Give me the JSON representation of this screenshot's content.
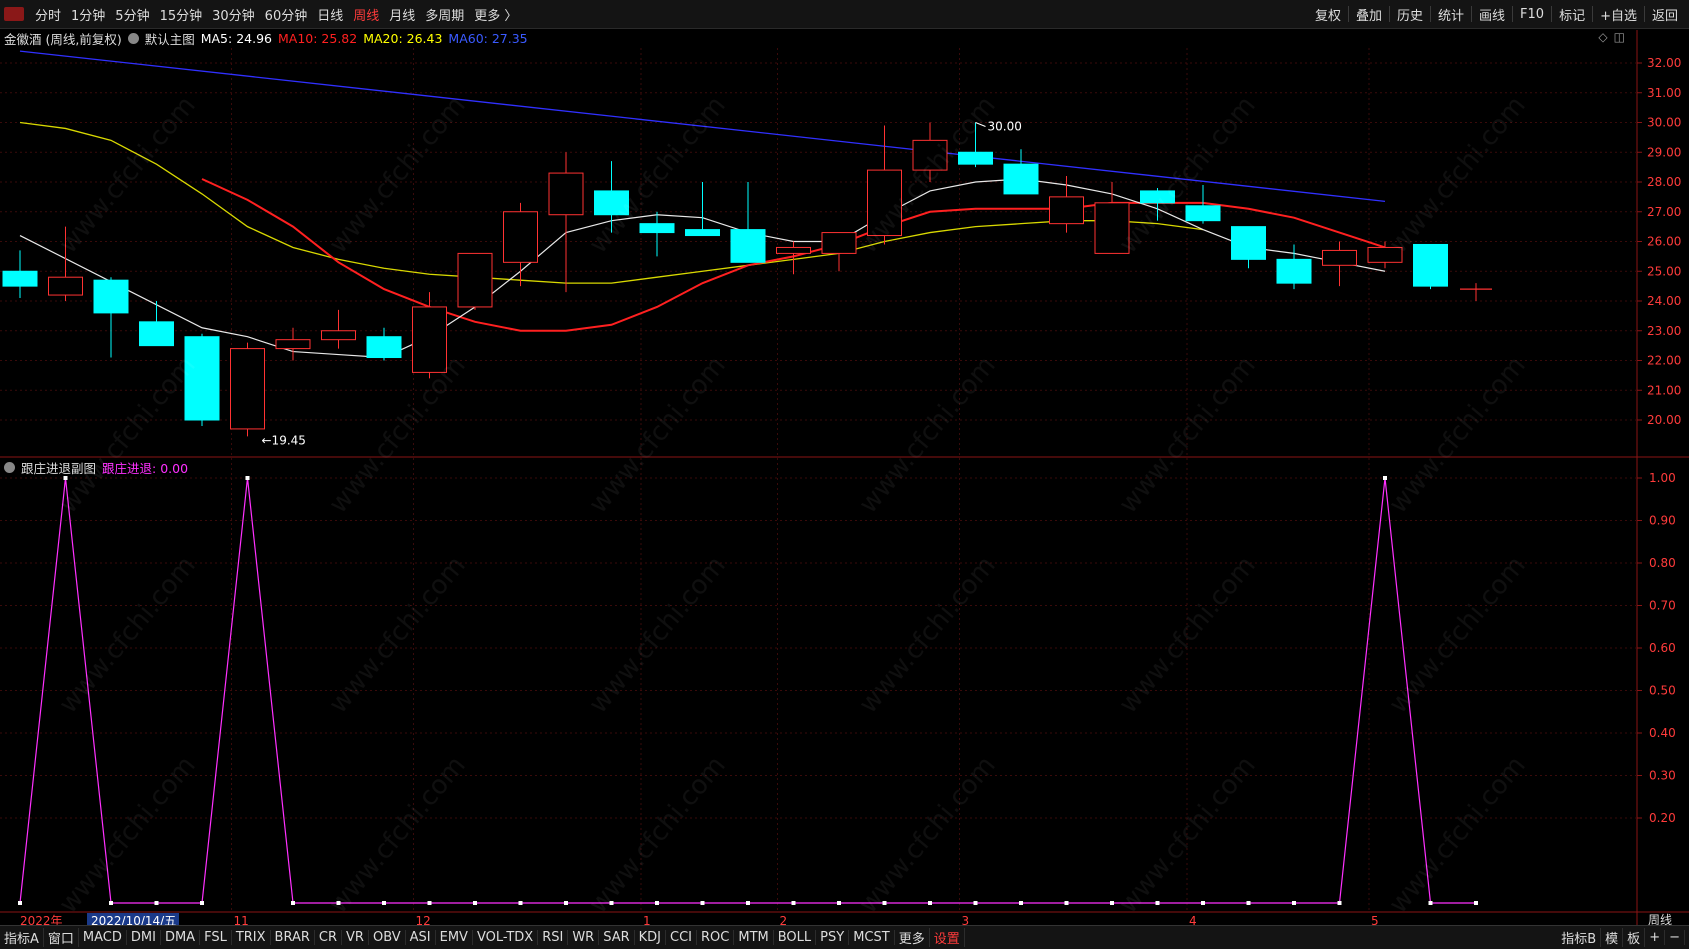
{
  "toolbar": {
    "periods": [
      "分时",
      "1分钟",
      "5分钟",
      "15分钟",
      "30分钟",
      "60分钟",
      "日线",
      "周线",
      "月线",
      "多周期",
      "更多 〉"
    ],
    "active_period": "周线",
    "right_buttons": [
      "复权",
      "叠加",
      "历史",
      "统计",
      "画线",
      "F10",
      "标记",
      "+自选",
      "返回"
    ]
  },
  "main_info": {
    "stock": "金徽酒 (周线,前复权)",
    "template": "默认主图",
    "ma5": "MA5: 24.96",
    "ma10": "MA10: 25.82",
    "ma20": "MA20: 26.43",
    "ma60": "MA60: 27.35",
    "colors": {
      "ma5": "#ffffff",
      "ma10": "#ff2020",
      "ma20": "#ffff00",
      "ma60": "#3030ff"
    }
  },
  "sub_info": {
    "name": "跟庄进退副图",
    "value": "跟庄进退: 0.00"
  },
  "x_axis": {
    "labels": [
      {
        "text": "2022年",
        "bar": 0
      },
      {
        "text": "2022/10/14/五",
        "bar": 2
      },
      {
        "text": "11",
        "bar": 5
      },
      {
        "text": "12",
        "bar": 9
      },
      {
        "text": "1",
        "bar": 14
      },
      {
        "text": "2",
        "bar": 17
      },
      {
        "text": "3",
        "bar": 21
      },
      {
        "text": "4",
        "bar": 26
      },
      {
        "text": "5",
        "bar": 30
      }
    ],
    "right_label": "周线"
  },
  "bottom_tabs": [
    "指标A",
    "窗口",
    "MACD",
    "DMI",
    "DMA",
    "FSL",
    "TRIX",
    "BRAR",
    "CR",
    "VR",
    "OBV",
    "ASI",
    "EMV",
    "VOL-TDX",
    "RSI",
    "WR",
    "SAR",
    "KDJ",
    "CCI",
    "ROC",
    "MTM",
    "BOLL",
    "PSY",
    "MCST",
    "更多",
    "设置"
  ],
  "bottom_right": [
    "指标B",
    "模",
    "板",
    "+",
    "−"
  ],
  "watermark": "www.cfchi.com",
  "chart_data": [
    {
      "type": "candlestick",
      "title": "金徽酒 (周线,前复权)",
      "y_ticks": [
        "32.00",
        "31.00",
        "30.00",
        "29.00",
        "28.00",
        "27.00",
        "26.00",
        "25.00",
        "24.00",
        "23.00",
        "22.00",
        "21.00",
        "20.00"
      ],
      "ylim": [
        19.2,
        32.7
      ],
      "annotations": [
        {
          "text": "30.00",
          "bar": 21,
          "value": 30.0
        },
        {
          "text": "19.45",
          "bar": 5,
          "value": 19.45
        }
      ],
      "colors": {
        "up": "#ff3232",
        "down": "#00ffff"
      },
      "ohlc": [
        [
          25.0,
          25.7,
          24.1,
          24.5
        ],
        [
          24.2,
          26.5,
          24.0,
          24.8
        ],
        [
          24.7,
          24.8,
          22.1,
          23.6
        ],
        [
          23.3,
          24.0,
          22.6,
          22.5
        ],
        [
          22.8,
          22.9,
          19.8,
          20.0
        ],
        [
          19.7,
          22.6,
          19.45,
          22.4
        ],
        [
          22.4,
          23.1,
          22.0,
          22.7
        ],
        [
          22.7,
          23.7,
          22.4,
          23.0
        ],
        [
          22.8,
          23.1,
          22.0,
          22.1
        ],
        [
          21.6,
          24.3,
          21.4,
          23.8
        ],
        [
          23.8,
          25.6,
          23.7,
          25.6
        ],
        [
          25.3,
          27.3,
          24.5,
          27.0
        ],
        [
          26.9,
          29.0,
          24.3,
          28.3
        ],
        [
          27.7,
          28.7,
          26.3,
          26.9
        ],
        [
          26.6,
          27.0,
          25.5,
          26.3
        ],
        [
          26.4,
          28.0,
          26.2,
          26.2
        ],
        [
          26.4,
          28.0,
          25.3,
          25.3
        ],
        [
          25.6,
          26.0,
          24.9,
          25.8
        ],
        [
          25.6,
          26.3,
          25.0,
          26.3
        ],
        [
          26.2,
          29.9,
          25.9,
          28.4
        ],
        [
          28.4,
          30.0,
          28.0,
          29.4
        ],
        [
          29.0,
          30.0,
          28.5,
          28.6
        ],
        [
          28.6,
          29.1,
          27.6,
          27.6
        ],
        [
          26.6,
          28.2,
          26.3,
          27.5
        ],
        [
          25.6,
          28.0,
          25.6,
          27.3
        ],
        [
          27.7,
          27.8,
          26.7,
          27.3
        ],
        [
          27.2,
          27.9,
          26.6,
          26.7
        ],
        [
          26.5,
          26.5,
          25.1,
          25.4
        ],
        [
          25.4,
          25.9,
          24.4,
          24.6
        ],
        [
          25.2,
          26.0,
          24.5,
          25.7
        ],
        [
          25.3,
          26.0,
          25.1,
          25.8
        ],
        [
          25.9,
          25.9,
          24.4,
          24.5
        ],
        [
          24.4,
          24.6,
          24.0,
          24.4
        ]
      ],
      "ma5": [
        26.2,
        null,
        null,
        null,
        23.1,
        22.8,
        22.3,
        22.2,
        22.1,
        22.8,
        23.8,
        25.0,
        26.3,
        26.7,
        26.9,
        26.8,
        26.3,
        26.0,
        26.0,
        26.9,
        27.7,
        28.0,
        28.1,
        27.9,
        27.6,
        27.1,
        26.4,
        25.8,
        25.6,
        25.3,
        25.0
      ],
      "ma10": [
        28.1,
        27.4,
        26.5,
        25.3,
        24.4,
        23.8,
        23.3,
        23.0,
        23.0,
        23.2,
        23.8,
        24.6,
        25.2,
        25.5,
        25.9,
        26.5,
        27.0,
        27.1,
        27.1,
        27.1,
        27.3,
        27.3,
        27.3,
        27.1,
        26.8,
        26.3,
        25.8
      ],
      "ma20": [
        30.0,
        29.8,
        29.4,
        28.6,
        27.6,
        26.5,
        25.8,
        25.4,
        25.1,
        24.9,
        24.8,
        24.7,
        24.6,
        24.6,
        24.8,
        25.0,
        25.2,
        25.4,
        25.6,
        26.0,
        26.3,
        26.5,
        26.6,
        26.7,
        26.7,
        26.6,
        26.4
      ],
      "ma60": [
        32.4,
        27.35
      ]
    },
    {
      "type": "line",
      "title": "跟庄进退副图",
      "series": [
        {
          "name": "跟庄进退",
          "values": [
            0,
            1,
            0,
            0,
            0,
            1,
            0,
            0,
            0,
            0,
            0,
            0,
            0,
            0,
            0,
            0,
            0,
            0,
            0,
            0,
            0,
            0,
            0,
            0,
            0,
            0,
            0,
            0,
            0,
            0,
            1,
            0,
            0
          ]
        }
      ],
      "y_ticks": [
        "1.00",
        "0.90",
        "0.80",
        "0.70",
        "0.60",
        "0.50",
        "0.40",
        "0.30",
        "0.20"
      ],
      "ylim": [
        0,
        1
      ],
      "color": "#ff30ff"
    }
  ]
}
